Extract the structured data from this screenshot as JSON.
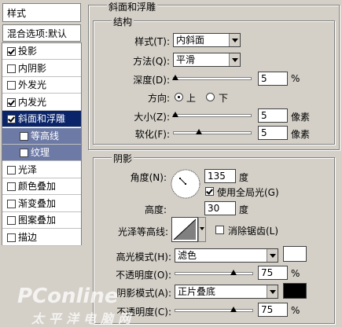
{
  "styles_list": {
    "header": "样式",
    "blend_default": "混合选项:默认",
    "items": [
      {
        "label": "投影",
        "checked": true
      },
      {
        "label": "内阴影",
        "checked": false
      },
      {
        "label": "外发光",
        "checked": false
      },
      {
        "label": "内发光",
        "checked": true
      },
      {
        "label": "斜面和浮雕",
        "checked": true,
        "selected": true
      },
      {
        "label": "等高线",
        "checked": false,
        "sub": true
      },
      {
        "label": "纹理",
        "checked": false,
        "sub": true
      },
      {
        "label": "光泽",
        "checked": false
      },
      {
        "label": "颜色叠加",
        "checked": false
      },
      {
        "label": "渐变叠加",
        "checked": false
      },
      {
        "label": "图案叠加",
        "checked": false
      },
      {
        "label": "描边",
        "checked": false
      }
    ]
  },
  "bevel": {
    "title": "斜面和浮雕",
    "structure": {
      "title": "结构",
      "style_label": "样式(T):",
      "style_value": "内斜面",
      "technique_label": "方法(Q):",
      "technique_value": "平滑",
      "depth_label": "深度(D):",
      "depth_value": "5",
      "depth_unit": "%",
      "depth_level": 0.02,
      "direction_label": "方向:",
      "direction_up": "上",
      "direction_down": "下",
      "direction_selected": "up",
      "size_label": "大小(Z):",
      "size_value": "5",
      "size_unit": "像素",
      "size_level": 0.02,
      "soften_label": "软化(F):",
      "soften_value": "5",
      "soften_unit": "像素",
      "soften_level": 0.33
    },
    "shading": {
      "title": "阴影",
      "angle_label": "角度(N):",
      "angle_value": "135",
      "angle_unit": "度",
      "global_light_label": "使用全局光(G)",
      "global_light_checked": true,
      "altitude_label": "高度:",
      "altitude_value": "30",
      "altitude_unit": "度",
      "gloss_contour_label": "光泽等高线:",
      "anti_alias_label": "消除锯齿(L)",
      "anti_alias_checked": false,
      "highlight_mode_label": "高光模式(H):",
      "highlight_mode_value": "滤色",
      "highlight_color": "#ffffff",
      "highlight_opacity_label": "不透明度(O):",
      "highlight_opacity_value": "75",
      "highlight_opacity_unit": "%",
      "highlight_opacity_level": 0.75,
      "shadow_mode_label": "阴影模式(A):",
      "shadow_mode_value": "正片叠底",
      "shadow_color": "#000000",
      "shadow_opacity_label": "不透明度(C):",
      "shadow_opacity_value": "75",
      "shadow_opacity_unit": "%",
      "shadow_opacity_level": 0.75
    }
  },
  "watermark": {
    "brand": "PConline",
    "cn": "太平洋电脑网"
  }
}
